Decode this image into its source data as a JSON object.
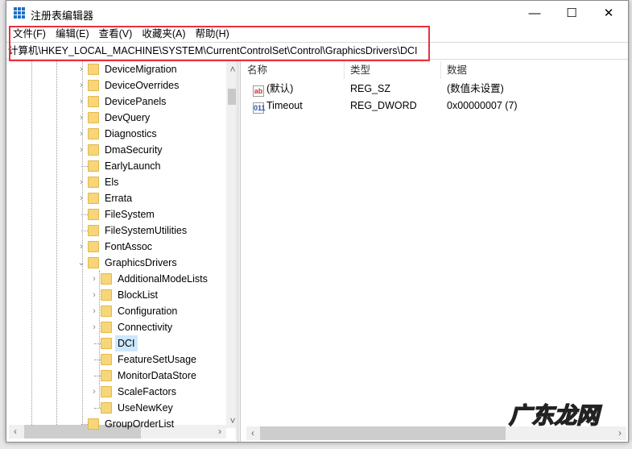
{
  "window": {
    "title": "注册表编辑器",
    "minimize": "—",
    "maximize": "☐",
    "close": "✕"
  },
  "menu": [
    "文件(F)",
    "编辑(E)",
    "查看(V)",
    "收藏夹(A)",
    "帮助(H)"
  ],
  "address": "计算机\\HKEY_LOCAL_MACHINE\\SYSTEM\\CurrentControlSet\\Control\\GraphicsDrivers\\DCI",
  "tree": [
    {
      "label": "DeviceMigration",
      "level": 1,
      "expander": ">"
    },
    {
      "label": "DeviceOverrides",
      "level": 1,
      "expander": ">"
    },
    {
      "label": "DevicePanels",
      "level": 1,
      "expander": ">"
    },
    {
      "label": "DevQuery",
      "level": 1,
      "expander": ">"
    },
    {
      "label": "Diagnostics",
      "level": 1,
      "expander": ">"
    },
    {
      "label": "DmaSecurity",
      "level": 1,
      "expander": ">"
    },
    {
      "label": "EarlyLaunch",
      "level": 1,
      "expander": ""
    },
    {
      "label": "Els",
      "level": 1,
      "expander": ">"
    },
    {
      "label": "Errata",
      "level": 1,
      "expander": ">"
    },
    {
      "label": "FileSystem",
      "level": 1,
      "expander": ""
    },
    {
      "label": "FileSystemUtilities",
      "level": 1,
      "expander": ""
    },
    {
      "label": "FontAssoc",
      "level": 1,
      "expander": ">"
    },
    {
      "label": "GraphicsDrivers",
      "level": 1,
      "expander": "v"
    },
    {
      "label": "AdditionalModeLists",
      "level": 2,
      "expander": ">"
    },
    {
      "label": "BlockList",
      "level": 2,
      "expander": ">"
    },
    {
      "label": "Configuration",
      "level": 2,
      "expander": ">"
    },
    {
      "label": "Connectivity",
      "level": 2,
      "expander": ">"
    },
    {
      "label": "DCI",
      "level": 2,
      "expander": "",
      "selected": true
    },
    {
      "label": "FeatureSetUsage",
      "level": 2,
      "expander": ""
    },
    {
      "label": "MonitorDataStore",
      "level": 2,
      "expander": ""
    },
    {
      "label": "ScaleFactors",
      "level": 2,
      "expander": ">"
    },
    {
      "label": "UseNewKey",
      "level": 2,
      "expander": ""
    },
    {
      "label": "GroupOrderList",
      "level": 1,
      "expander": ""
    }
  ],
  "columns": [
    "名称",
    "类型",
    "数据"
  ],
  "values": [
    {
      "name": "(默认)",
      "type": "REG_SZ",
      "data": "(数值未设置)",
      "icon": "ab"
    },
    {
      "name": "Timeout",
      "type": "REG_DWORD",
      "data": "0x00000007 (7)",
      "icon": "011"
    }
  ],
  "watermark": "广东龙网"
}
